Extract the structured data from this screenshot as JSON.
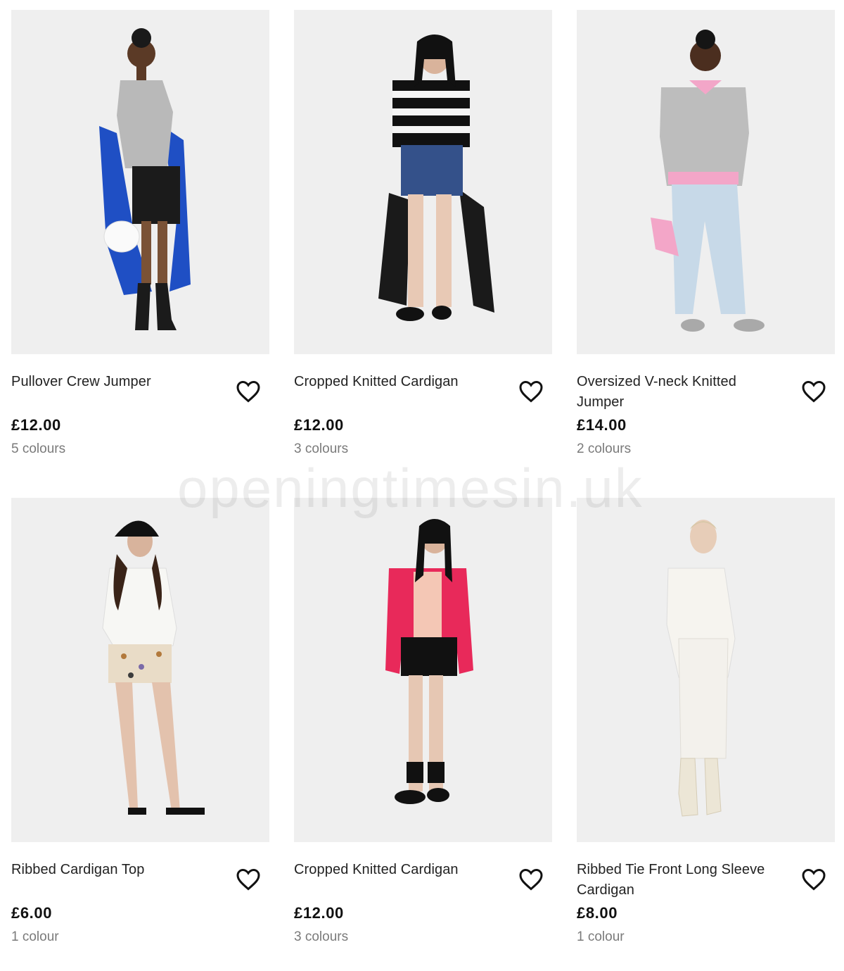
{
  "products": [
    {
      "name": "Pullover Crew Jumper",
      "price": "£12.00",
      "colours": "5 colours"
    },
    {
      "name": "Cropped Knitted Cardigan",
      "price": "£12.00",
      "colours": "3 colours"
    },
    {
      "name": "Oversized V-neck Knitted Jumper",
      "price": "£14.00",
      "colours": "2 colours"
    },
    {
      "name": "Ribbed Cardigan Top",
      "price": "£6.00",
      "colours": "1 colour"
    },
    {
      "name": "Cropped Knitted Cardigan",
      "price": "£12.00",
      "colours": "3 colours"
    },
    {
      "name": "Ribbed Tie Front Long Sleeve Cardigan",
      "price": "£8.00",
      "colours": "1 colour"
    }
  ],
  "watermark": "openingtimesin.uk",
  "icons": {
    "favourite": "heart-outline-icon"
  },
  "colors": {
    "photo_bg": "#efefef",
    "price": "#111111",
    "muted": "#7a7a7a"
  }
}
